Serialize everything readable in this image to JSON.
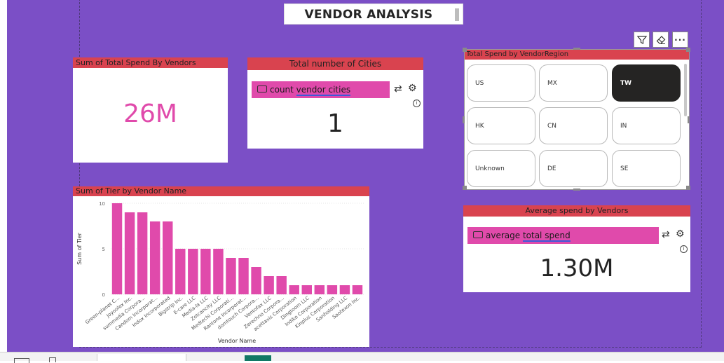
{
  "report": {
    "title": "VENDOR ANALYSIS"
  },
  "toolbar": {
    "filter_icon": "filter-icon",
    "eraser_icon": "eraser-icon",
    "more_label": "···"
  },
  "card_total_spend": {
    "header": "Sum of Total Spend By Vendors",
    "value": "26M",
    "value_color": "#e04aab"
  },
  "card_cities": {
    "header": "Total number of Cities",
    "qa_prefix": "count ",
    "qa_query": "vendor cities",
    "value": "1"
  },
  "slicer": {
    "header": "Total Spend by VendorRegion",
    "options": [
      {
        "label": "US",
        "selected": false
      },
      {
        "label": "MX",
        "selected": false
      },
      {
        "label": "TW",
        "selected": true
      },
      {
        "label": "HK",
        "selected": false
      },
      {
        "label": "CN",
        "selected": false
      },
      {
        "label": "IN",
        "selected": false
      },
      {
        "label": "Unknown",
        "selected": false
      },
      {
        "label": "DE",
        "selected": false
      },
      {
        "label": "SE",
        "selected": false
      }
    ]
  },
  "card_avg_spend": {
    "header": "Average spend by Vendors",
    "qa_prefix": "average ",
    "qa_query": "total spend",
    "value": "1.30M"
  },
  "chart_card": {
    "header": "Sum of Tier by Vendor Name"
  },
  "colors": {
    "canvas": "#7b4fc6",
    "header": "#d9434f",
    "accent_pink": "#e04aab",
    "bar": "#e04aab"
  },
  "chart_data": {
    "type": "bar",
    "xlabel": "Vendor Name",
    "ylabel": "Sum of Tier",
    "ylim": [
      0,
      10
    ],
    "yticks": [
      0,
      5,
      10
    ],
    "grid": true,
    "categories": [
      "Green-planet C...",
      "Joyoolex Inc.",
      "summedia Corpora...",
      "Candom Incorporat...",
      "Indox Incorporated",
      "Bigstrip Inc.",
      "E-care LLC",
      "Media-la LLC",
      "Zotcancity LLC",
      "Medtechi Corporati...",
      "Rantone Incorporat...",
      "domtouch Corpora...",
      "Ventofax LLC",
      "Zerechno Corpora...",
      "acettaxis Corporation",
      "Dingtoom LLC",
      "Indiko Corporation",
      "Kinplus Corporation",
      "Sanholding LLC",
      "Saotexon Inc."
    ],
    "values": [
      10,
      9,
      9,
      8,
      8,
      5,
      5,
      5,
      5,
      4,
      4,
      3,
      2,
      2,
      1,
      1,
      1,
      1,
      1,
      1
    ]
  }
}
